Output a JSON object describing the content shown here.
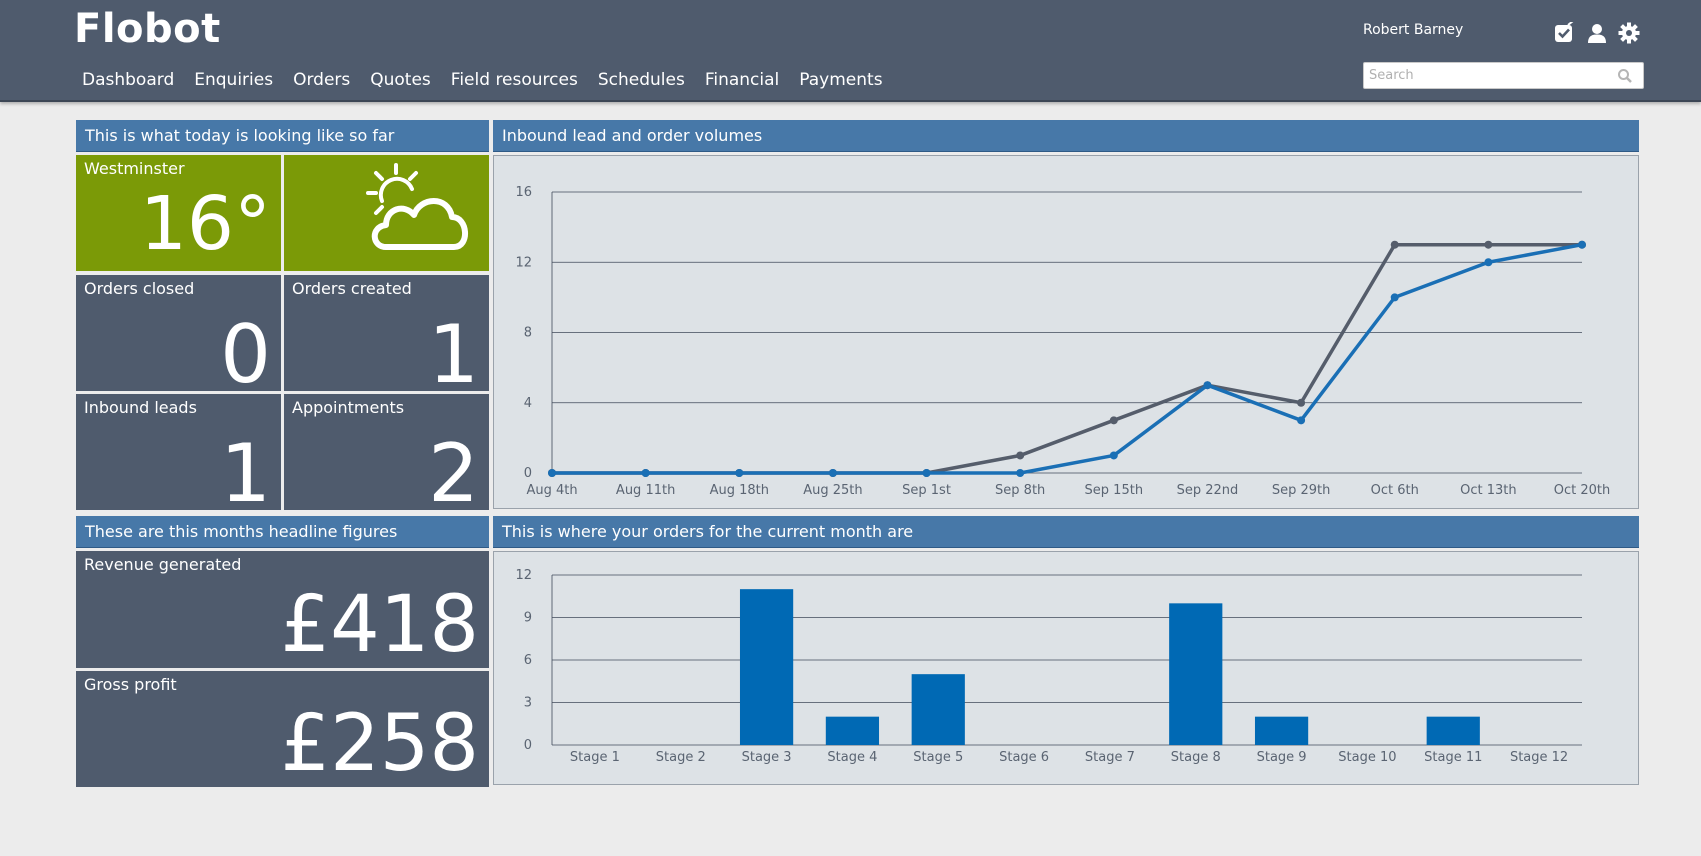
{
  "app": {
    "logo": "Flobot",
    "user_name": "Robert Barney",
    "search_placeholder": "Search",
    "nav": [
      "Dashboard",
      "Enquiries",
      "Orders",
      "Quotes",
      "Field resources",
      "Schedules",
      "Financial",
      "Payments"
    ]
  },
  "today": {
    "heading": "This is what today is looking like so far",
    "weather": {
      "location": "Westminster",
      "temperature": "16°",
      "icon": "partly-cloudy-icon"
    },
    "tiles": [
      {
        "label": "Orders closed",
        "value": "0"
      },
      {
        "label": "Orders created",
        "value": "1"
      },
      {
        "label": "Inbound leads",
        "value": "1"
      },
      {
        "label": "Appointments",
        "value": "2"
      }
    ]
  },
  "month": {
    "heading": "These are this months headline figures",
    "tiles": [
      {
        "label": "Revenue generated",
        "value": "£418"
      },
      {
        "label": "Gross profit",
        "value": "£258"
      }
    ]
  },
  "line_panel": {
    "heading": "Inbound lead and order volumes"
  },
  "bar_panel": {
    "heading": "This is where your orders for the current month are"
  },
  "colors": {
    "header": "#4f5b6d",
    "panel_head": "#4778a8",
    "tile": "#4f5b6d",
    "weather": "#7b9a07",
    "series_grey": "#555d6b",
    "series_blue": "#1a6fb5",
    "bar": "#0069b4"
  },
  "chart_data": [
    {
      "type": "line",
      "categories": [
        "Aug 4th",
        "Aug 11th",
        "Aug 18th",
        "Aug 25th",
        "Sep 1st",
        "Sep 8th",
        "Sep 15th",
        "Sep 22nd",
        "Sep 29th",
        "Oct 6th",
        "Oct 13th",
        "Oct 20th"
      ],
      "series": [
        {
          "values": [
            0,
            0,
            0,
            0,
            0,
            1,
            3,
            5,
            4,
            13,
            13,
            13
          ],
          "color": "#555d6b"
        },
        {
          "values": [
            0,
            0,
            0,
            0,
            0,
            0,
            1,
            5,
            3,
            10,
            12,
            13
          ],
          "color": "#1a6fb5"
        }
      ],
      "yticks": [
        0,
        4,
        8,
        12,
        16
      ],
      "ylim": [
        0,
        16
      ],
      "grid": true
    },
    {
      "type": "bar",
      "categories": [
        "Stage 1",
        "Stage 2",
        "Stage 3",
        "Stage 4",
        "Stage 5",
        "Stage 6",
        "Stage 7",
        "Stage 8",
        "Stage 9",
        "Stage 10",
        "Stage 11",
        "Stage 12"
      ],
      "values": [
        0,
        0,
        11,
        2,
        5,
        0,
        0,
        10,
        2,
        0,
        2,
        0
      ],
      "yticks": [
        0,
        3,
        6,
        9,
        12
      ],
      "ylim": [
        0,
        12
      ],
      "color": "#0069b4",
      "grid": true
    }
  ]
}
